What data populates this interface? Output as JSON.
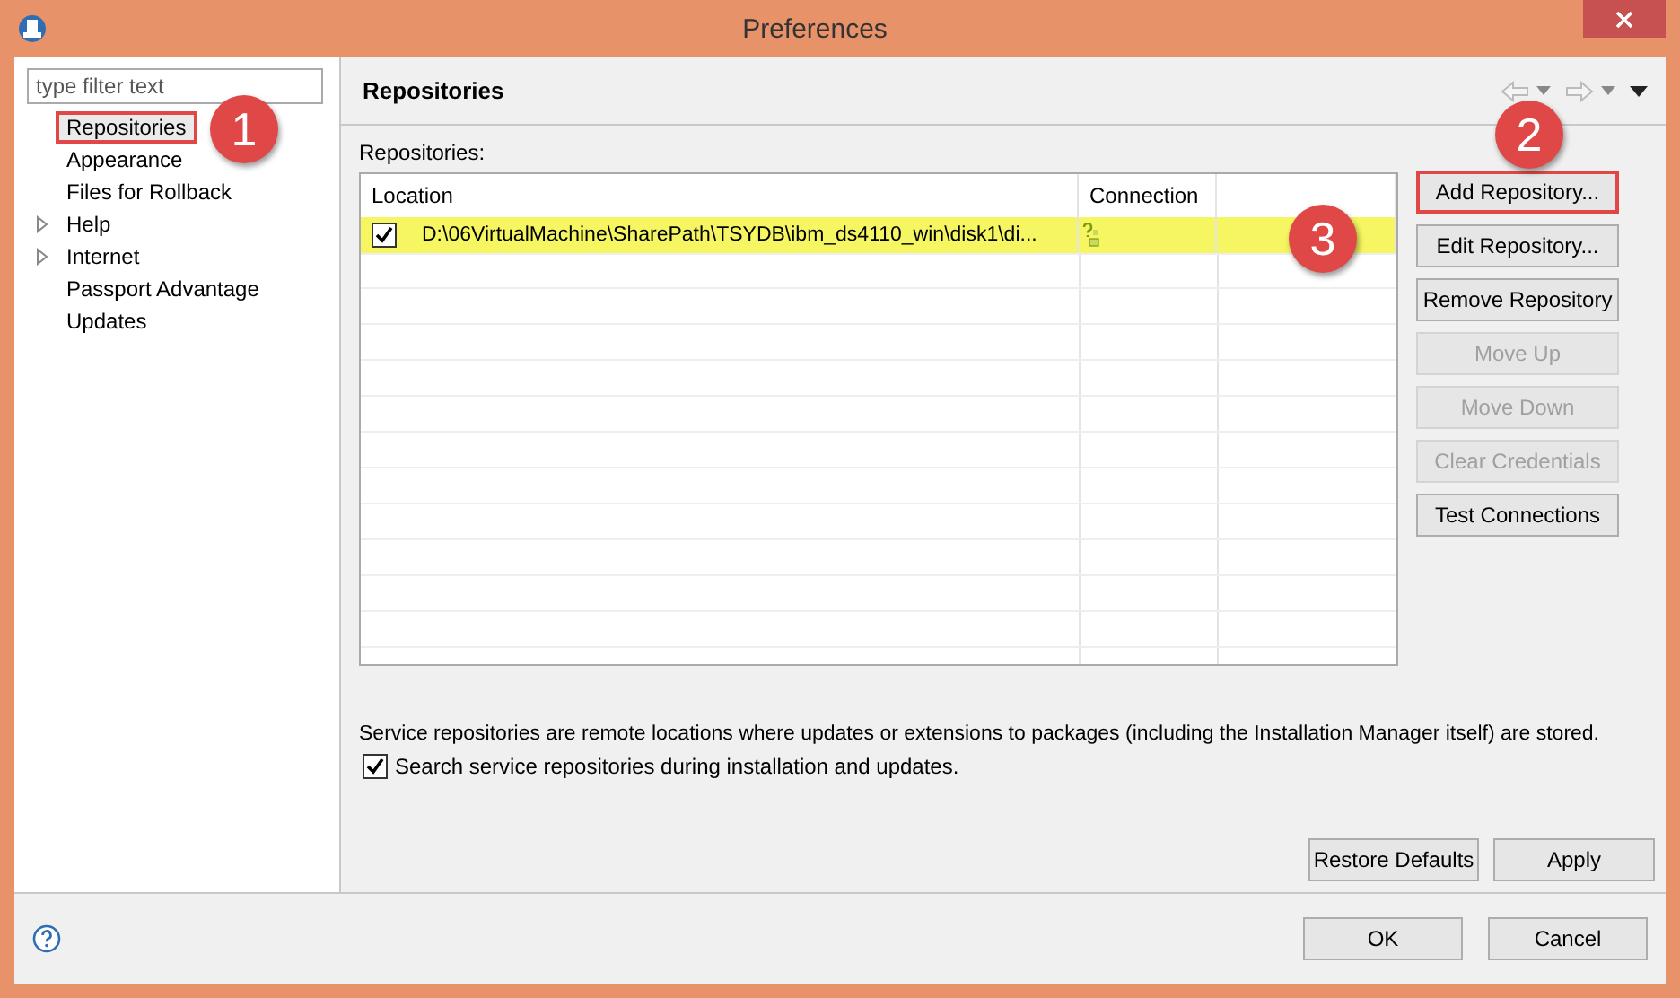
{
  "window": {
    "title": "Preferences"
  },
  "filter": {
    "placeholder": "type filter text"
  },
  "sidebar": {
    "items": [
      {
        "label": "Repositories",
        "kind": "leaf",
        "selected": true,
        "highlighted": true
      },
      {
        "label": "Appearance",
        "kind": "leaf",
        "selected": false,
        "highlighted": false
      },
      {
        "label": "Files for Rollback",
        "kind": "leaf",
        "selected": false,
        "highlighted": false
      },
      {
        "label": "Help",
        "kind": "branch",
        "selected": false,
        "highlighted": false
      },
      {
        "label": "Internet",
        "kind": "branch",
        "selected": false,
        "highlighted": false
      },
      {
        "label": "Passport Advantage",
        "kind": "leaf",
        "selected": false,
        "highlighted": false
      },
      {
        "label": "Updates",
        "kind": "leaf",
        "selected": false,
        "highlighted": false
      }
    ]
  },
  "page": {
    "title": "Repositories",
    "list_label": "Repositories:"
  },
  "table": {
    "columns": [
      "Location",
      "Connection"
    ],
    "rows": [
      {
        "checked": true,
        "location": "D:\\06VirtualMachine\\SharePath\\TSYDB\\ibm_ds4110_win\\disk1\\di...",
        "highlighted": true
      }
    ]
  },
  "side_buttons": [
    {
      "label": "Add Repository...",
      "disabled": false,
      "highlighted": true
    },
    {
      "label": "Edit Repository...",
      "disabled": false,
      "highlighted": false
    },
    {
      "label": "Remove Repository",
      "disabled": false,
      "highlighted": false
    },
    {
      "label": "Move Up",
      "disabled": true,
      "highlighted": false
    },
    {
      "label": "Move Down",
      "disabled": true,
      "highlighted": false
    },
    {
      "label": "Clear Credentials",
      "disabled": true,
      "highlighted": false
    },
    {
      "label": "Test Connections",
      "disabled": false,
      "highlighted": false
    }
  ],
  "description": "Service repositories are remote locations where updates or extensions to packages (including the Installation Manager itself) are stored.",
  "search_option": {
    "label": "Search service repositories during installation and updates.",
    "checked": true
  },
  "page_buttons": [
    "Restore Defaults",
    "Apply"
  ],
  "dialog_buttons": [
    "OK",
    "Cancel"
  ],
  "callouts": [
    {
      "label": "1"
    },
    {
      "label": "2"
    },
    {
      "label": "3"
    }
  ]
}
